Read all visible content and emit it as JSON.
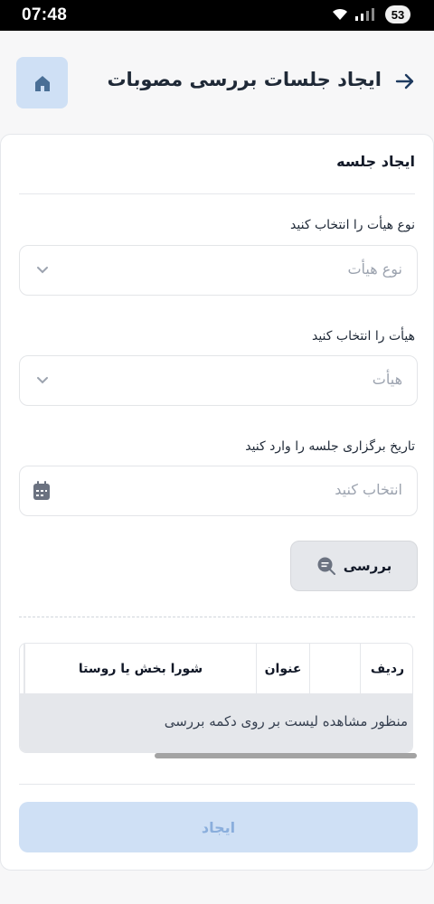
{
  "status_bar": {
    "time": "07:48",
    "battery": "53"
  },
  "header": {
    "title": "ایجاد جلسات بررسی مصوبات"
  },
  "form": {
    "title": "ایجاد جلسه",
    "board_type": {
      "label": "نوع هیأت را انتخاب کنید",
      "placeholder": "نوع هیأت"
    },
    "board": {
      "label": "هیأت را انتخاب کنید",
      "placeholder": "هیأت"
    },
    "date": {
      "label": "تاریخ برگزاری جلسه را وارد کنید",
      "placeholder": "انتخاب کنید"
    },
    "review_button": "بررسی"
  },
  "table": {
    "columns": [
      "ردیف",
      "",
      "عنوان",
      "شورا بخش یا روستا"
    ],
    "empty_message": "به منظور مشاهده لیست بر روی دکمه بررسی"
  },
  "create_button": "ایجاد",
  "colors": {
    "accent_light": "#cfe0f5",
    "accent_text": "#8aaedc",
    "dark_blue": "#1e3a5f"
  },
  "icons": {
    "home": "home-icon",
    "back": "arrow-right-icon",
    "chevron": "chevron-down-icon",
    "calendar": "calendar-icon",
    "review": "search-list-icon"
  }
}
